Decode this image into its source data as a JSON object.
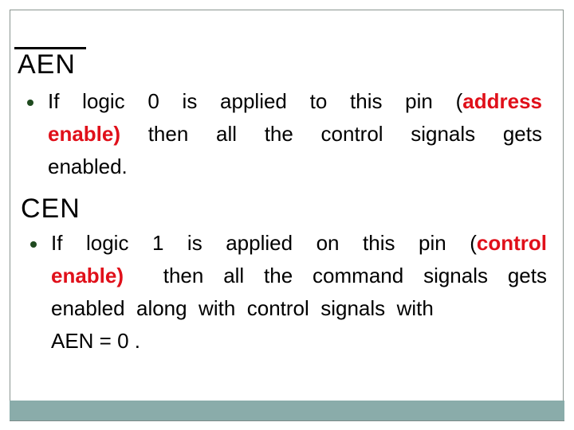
{
  "slide": {
    "colors": {
      "accent_red": "#e0101a",
      "bullet_green": "#1f4a1f",
      "footer_bar": "#8aacaa",
      "frame_border": "#8a9590"
    },
    "sections": [
      {
        "heading": "AEN",
        "heading_overlined": true,
        "bullet": {
          "lines": [
            {
              "parts": [
                {
                  "text": "If  logic  0  is  applied  to  this  pin  (",
                  "style": "normal"
                },
                {
                  "text": "address",
                  "style": "red-bold"
                }
              ]
            },
            {
              "parts": [
                {
                  "text": "enable)",
                  "style": "red-bold"
                },
                {
                  "text": "  then  all  the  control  signals  gets",
                  "style": "normal"
                }
              ]
            },
            {
              "parts": [
                {
                  "text": "enabled.",
                  "style": "normal"
                }
              ]
            }
          ]
        }
      },
      {
        "heading": "CEN",
        "heading_overlined": false,
        "bullet": {
          "lines": [
            {
              "parts": [
                {
                  "text": "If  logic  1  is  applied  on  this  pin  (",
                  "style": "normal"
                },
                {
                  "text": "control",
                  "style": "red-bold"
                }
              ]
            },
            {
              "parts": [
                {
                  "text": "enable)",
                  "style": "red-bold"
                },
                {
                  "text": "  then all the command signals gets",
                  "style": "normal"
                }
              ]
            },
            {
              "parts": [
                {
                  "text": "enabled  along  with  control  signals  with",
                  "style": "normal"
                }
              ]
            },
            {
              "parts": [
                {
                  "text": "AEN = 0 .",
                  "style": "normal"
                }
              ]
            }
          ]
        }
      }
    ]
  }
}
